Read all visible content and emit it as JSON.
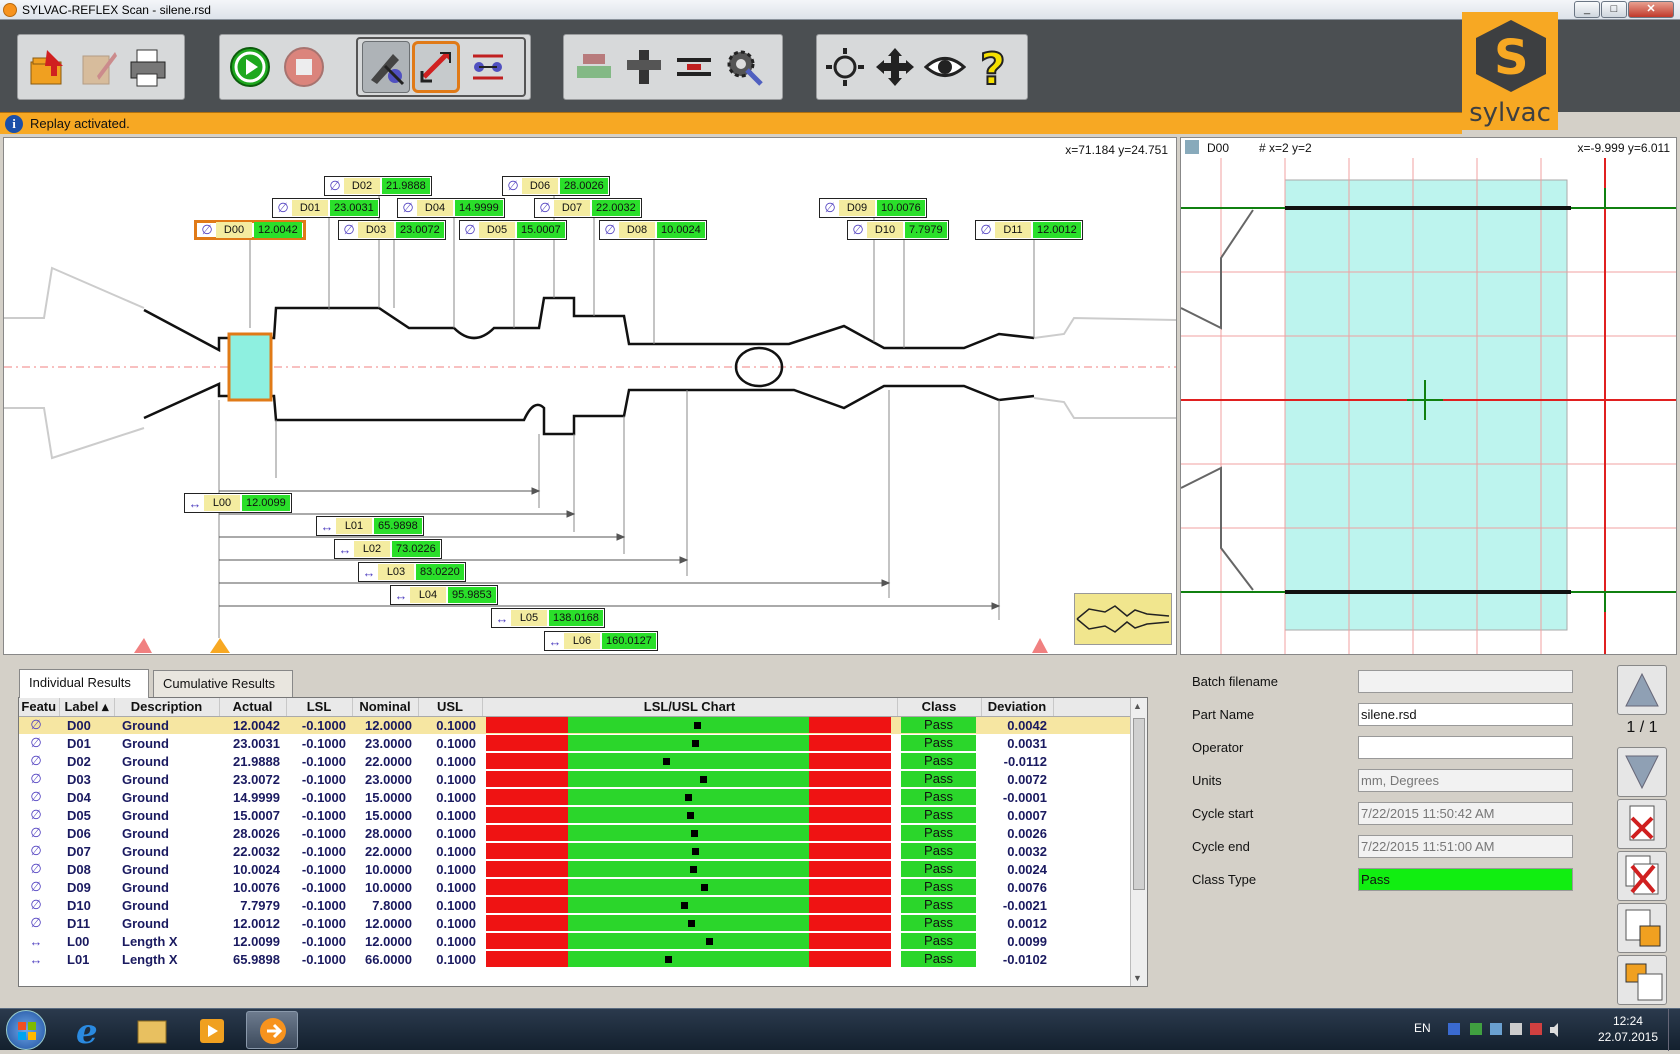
{
  "window": {
    "title": "SYLVAC-REFLEX Scan - silene.rsd",
    "min": "_",
    "max": "□",
    "close": "✕"
  },
  "status": {
    "message": "Replay activated."
  },
  "logo": {
    "word": "sylvac",
    "mark": "S"
  },
  "toolbar": {
    "groups": [
      [
        "open-icon",
        "save-icon",
        "print-icon"
      ],
      [
        "play-icon",
        "stop-icon",
        "measure-tools-icon",
        "replay-icon",
        "feature-icon"
      ],
      [
        "profile-icon",
        "calibrate-icon",
        "length-icon",
        "settings-icon"
      ],
      [
        "zoom-fit-icon",
        "pan-icon",
        "view-icon",
        "help-icon"
      ]
    ]
  },
  "mainview": {
    "coords": "x=71.184 y=24.751",
    "diameters": [
      {
        "name": "D00",
        "value": "12.0042"
      },
      {
        "name": "D01",
        "value": "23.0031"
      },
      {
        "name": "D02",
        "value": "21.9888"
      },
      {
        "name": "D03",
        "value": "23.0072"
      },
      {
        "name": "D04",
        "value": "14.9999"
      },
      {
        "name": "D05",
        "value": "15.0007"
      },
      {
        "name": "D06",
        "value": "28.0026"
      },
      {
        "name": "D07",
        "value": "22.0032"
      },
      {
        "name": "D08",
        "value": "10.0024"
      },
      {
        "name": "D09",
        "value": "10.0076"
      },
      {
        "name": "D10",
        "value": "7.7979"
      },
      {
        "name": "D11",
        "value": "12.0012"
      }
    ],
    "lengths": [
      {
        "name": "L00",
        "value": "12.0099"
      },
      {
        "name": "L01",
        "value": "65.9898"
      },
      {
        "name": "L02",
        "value": "73.0226"
      },
      {
        "name": "L03",
        "value": "83.0220"
      },
      {
        "name": "L04",
        "value": "95.9853"
      },
      {
        "name": "L05",
        "value": "138.0168"
      },
      {
        "name": "L06",
        "value": "160.0127"
      }
    ]
  },
  "zoomview": {
    "feature": "D00",
    "grid": "# x=2 y=2",
    "coords": "x=-9.999 y=6.011"
  },
  "results": {
    "tabs": [
      "Individual Results",
      "Cumulative Results"
    ],
    "headers": [
      "Featu",
      "Label",
      "Description",
      "Actual",
      "LSL",
      "Nominal",
      "USL",
      "LSL/USL Chart",
      "Class",
      "Deviation"
    ],
    "rows": [
      {
        "icon": "∅",
        "label": "D00",
        "desc": "Ground",
        "actual": "12.0042",
        "lsl": "-0.1000",
        "nominal": "12.0000",
        "usl": "0.1000",
        "pos": 0.521,
        "cls": "Pass",
        "dev": "0.0042"
      },
      {
        "icon": "∅",
        "label": "D01",
        "desc": "Ground",
        "actual": "23.0031",
        "lsl": "-0.1000",
        "nominal": "23.0000",
        "usl": "0.1000",
        "pos": 0.516,
        "cls": "Pass",
        "dev": "0.0031"
      },
      {
        "icon": "∅",
        "label": "D02",
        "desc": "Ground",
        "actual": "21.9888",
        "lsl": "-0.1000",
        "nominal": "22.0000",
        "usl": "0.1000",
        "pos": 0.444,
        "cls": "Pass",
        "dev": "-0.0112"
      },
      {
        "icon": "∅",
        "label": "D03",
        "desc": "Ground",
        "actual": "23.0072",
        "lsl": "-0.1000",
        "nominal": "23.0000",
        "usl": "0.1000",
        "pos": 0.536,
        "cls": "Pass",
        "dev": "0.0072"
      },
      {
        "icon": "∅",
        "label": "D04",
        "desc": "Ground",
        "actual": "14.9999",
        "lsl": "-0.1000",
        "nominal": "15.0000",
        "usl": "0.1000",
        "pos": 0.499,
        "cls": "Pass",
        "dev": "-0.0001"
      },
      {
        "icon": "∅",
        "label": "D05",
        "desc": "Ground",
        "actual": "15.0007",
        "lsl": "-0.1000",
        "nominal": "15.0000",
        "usl": "0.1000",
        "pos": 0.503,
        "cls": "Pass",
        "dev": "0.0007"
      },
      {
        "icon": "∅",
        "label": "D06",
        "desc": "Ground",
        "actual": "28.0026",
        "lsl": "-0.1000",
        "nominal": "28.0000",
        "usl": "0.1000",
        "pos": 0.513,
        "cls": "Pass",
        "dev": "0.0026"
      },
      {
        "icon": "∅",
        "label": "D07",
        "desc": "Ground",
        "actual": "22.0032",
        "lsl": "-0.1000",
        "nominal": "22.0000",
        "usl": "0.1000",
        "pos": 0.516,
        "cls": "Pass",
        "dev": "0.0032"
      },
      {
        "icon": "∅",
        "label": "D08",
        "desc": "Ground",
        "actual": "10.0024",
        "lsl": "-0.1000",
        "nominal": "10.0000",
        "usl": "0.1000",
        "pos": 0.512,
        "cls": "Pass",
        "dev": "0.0024"
      },
      {
        "icon": "∅",
        "label": "D09",
        "desc": "Ground",
        "actual": "10.0076",
        "lsl": "-0.1000",
        "nominal": "10.0000",
        "usl": "0.1000",
        "pos": 0.538,
        "cls": "Pass",
        "dev": "0.0076"
      },
      {
        "icon": "∅",
        "label": "D10",
        "desc": "Ground",
        "actual": "7.7979",
        "lsl": "-0.1000",
        "nominal": "7.8000",
        "usl": "0.1000",
        "pos": 0.489,
        "cls": "Pass",
        "dev": "-0.0021"
      },
      {
        "icon": "∅",
        "label": "D11",
        "desc": "Ground",
        "actual": "12.0012",
        "lsl": "-0.1000",
        "nominal": "12.0000",
        "usl": "0.1000",
        "pos": 0.506,
        "cls": "Pass",
        "dev": "0.0012"
      },
      {
        "icon": "↔",
        "label": "L00",
        "desc": "Length X",
        "actual": "12.0099",
        "lsl": "-0.1000",
        "nominal": "12.0000",
        "usl": "0.1000",
        "pos": 0.55,
        "cls": "Pass",
        "dev": "0.0099"
      },
      {
        "icon": "↔",
        "label": "L01",
        "desc": "Length X",
        "actual": "65.9898",
        "lsl": "-0.1000",
        "nominal": "66.0000",
        "usl": "0.1000",
        "pos": 0.449,
        "cls": "Pass",
        "dev": "-0.0102"
      }
    ]
  },
  "info": {
    "fields": [
      {
        "label": "Batch filename",
        "value": "",
        "style": "grey"
      },
      {
        "label": "Part Name",
        "value": "silene.rsd",
        "style": "white"
      },
      {
        "label": "Operator",
        "value": "",
        "style": "white"
      },
      {
        "label": "Units",
        "value": "mm, Degrees",
        "style": "grey"
      },
      {
        "label": "Cycle start",
        "value": "7/22/2015 11:50:42 AM",
        "style": "grey"
      },
      {
        "label": "Cycle end",
        "value": "7/22/2015 11:51:00 AM",
        "style": "grey"
      },
      {
        "label": "Class Type",
        "value": "Pass",
        "style": "green"
      }
    ],
    "page": "1 / 1"
  },
  "taskbar": {
    "lang": "EN",
    "time": "12:24",
    "date": "22.07.2015"
  },
  "colors": {
    "accent": "#f7a823",
    "pass": "#2bd62b",
    "fail": "#ef1313"
  }
}
